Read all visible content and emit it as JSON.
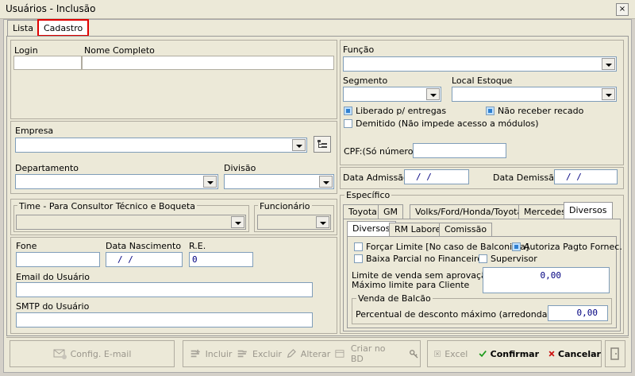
{
  "window": {
    "title": "Usuários - Inclusão",
    "close_glyph": "×"
  },
  "tabs": [
    {
      "label": "Lista"
    },
    {
      "label": "Cadastro"
    }
  ],
  "ident": {
    "login_label": "Login",
    "nome_label": "Nome Completo"
  },
  "empresa": {
    "label": "Empresa"
  },
  "departamento": {
    "label": "Departamento"
  },
  "divisao": {
    "label": "Divisão"
  },
  "time": {
    "label": "Time - Para Consultor Técnico e Boqueta"
  },
  "funcionario": {
    "label": "Funcionário"
  },
  "contato": {
    "fone_label": "Fone",
    "nasc_label": "Data Nascimento",
    "nasc_value": "/   /",
    "re_label": "R.E.",
    "re_value": "0",
    "email_label": "Email do Usuário",
    "smtp_label": "SMTP do Usuário"
  },
  "funcao": {
    "label": "Função"
  },
  "segmento": {
    "label": "Segmento"
  },
  "local_estoque": {
    "label": "Local Estoque"
  },
  "checks": {
    "liberado": "Liberado p/ entregas",
    "nao_receber": "Não receber recado",
    "demitido": "Demitido (Não impede acesso a módulos)"
  },
  "cpf": {
    "label": "CPF:(Só números)"
  },
  "datas": {
    "admissao_label": "Data Admissão",
    "admissao_value": "/   /",
    "demissao_label": "Data Demissão",
    "demissao_value": "/   /"
  },
  "especifico": {
    "title": "Específico",
    "tabs": [
      {
        "label": "Toyota"
      },
      {
        "label": "GM"
      },
      {
        "label": "Volks/Ford/Honda/Toyota"
      },
      {
        "label": "Mercedes"
      },
      {
        "label": "Diversos"
      }
    ],
    "subtabs": [
      {
        "label": "Diversos"
      },
      {
        "label": "RM Labore"
      },
      {
        "label": "Comissão"
      }
    ],
    "forcar_limite": "Forçar Limite [No caso de Balconista]",
    "autoriza": "Autoriza Pagto Fornec.",
    "baixa_parcial": "Baixa Parcial no Financeiro",
    "supervisor": "Supervisor",
    "limite_label_1": "Limite de venda sem aprovação ->",
    "limite_label_2": "Máximo limite para Cliente",
    "limite_value": "0,00",
    "balcao_title": "Venda de Balcão",
    "percentual_label": "Percentual de desconto máximo (arredondamento)",
    "percentual_value": "0,00"
  },
  "toolbar": {
    "config_email": "Config. E-mail",
    "incluir": "Incluir",
    "excluir": "Excluir",
    "alterar": "Alterar",
    "criar_bd": "Criar no BD",
    "excel": "Excel",
    "confirmar": "Confirmar",
    "cancelar": "Cancelar"
  },
  "colors": {
    "accent_red": "#e00000",
    "confirm_green": "#1a9a1a",
    "cancel_red": "#cc1010",
    "checked_blue": "#2f7fd0"
  }
}
